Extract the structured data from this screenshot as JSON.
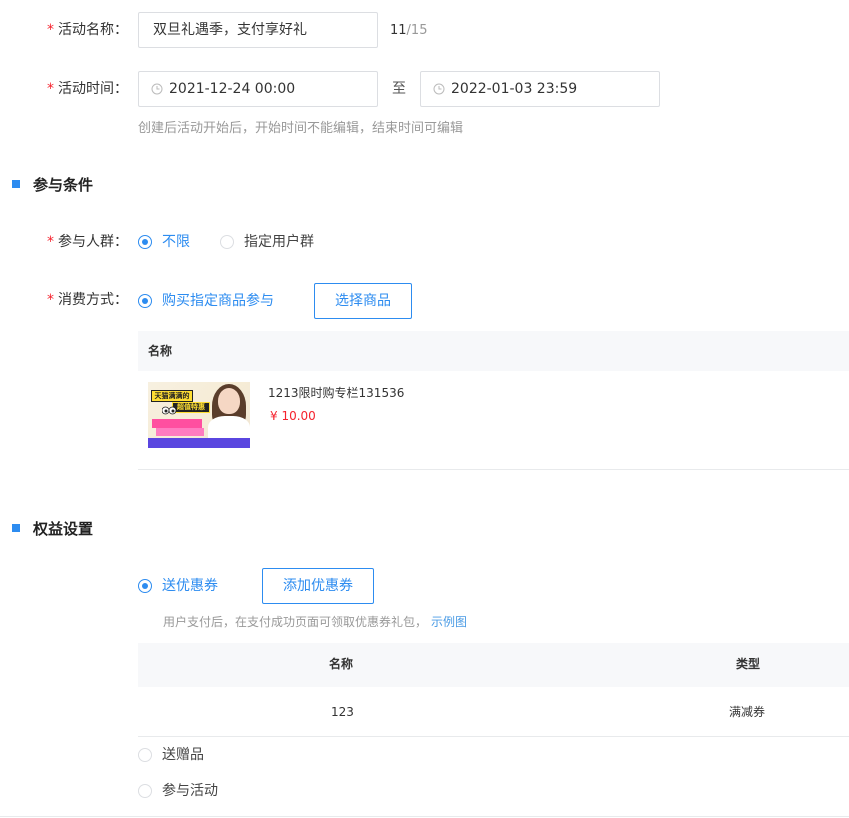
{
  "activity": {
    "name_label": "活动名称：",
    "name_value": "双旦礼遇季，支付享好礼",
    "name_count": "11",
    "name_max": "/15",
    "time_label": "活动时间：",
    "start_time": "2021-12-24 00:00",
    "to_label": "至",
    "end_time": "2022-01-03 23:59",
    "time_hint": "创建后活动开始后，开始时间不能编辑，结束时间可编辑"
  },
  "conditions": {
    "section_title": "参与条件",
    "audience_label": "参与人群：",
    "audience_options": [
      "不限",
      "指定用户群"
    ],
    "audience_selected": "不限",
    "consume_label": "消费方式：",
    "consume_option": "购买指定商品参与",
    "select_goods_button": "选择商品",
    "goods_table": {
      "header_name": "名称",
      "rows": [
        {
          "name": "1213限时购专栏131536",
          "price": "¥ 10.00",
          "thumb_text_1": "天猫满满的",
          "thumb_text_2": "超值特惠"
        }
      ]
    }
  },
  "benefits": {
    "section_title": "权益设置",
    "coupon_option": "送优惠券",
    "add_coupon_button": "添加优惠券",
    "coupon_hint": "用户支付后，在支付成功页面可领取优惠券礼包，",
    "coupon_hint_link": "示例图",
    "coupon_table": {
      "header_name": "名称",
      "header_type": "类型",
      "rows": [
        {
          "name": "123",
          "type": "满减券"
        }
      ]
    },
    "gift_option": "送赠品",
    "join_option": "参与活动"
  },
  "colors": {
    "primary": "#2d8cf0",
    "required": "#f5222d",
    "price": "#f5222d",
    "hint": "#999999",
    "table_header_bg": "#f7f8fa"
  },
  "icons": {
    "time": "clock-icon",
    "section": "section-marker-icon"
  }
}
